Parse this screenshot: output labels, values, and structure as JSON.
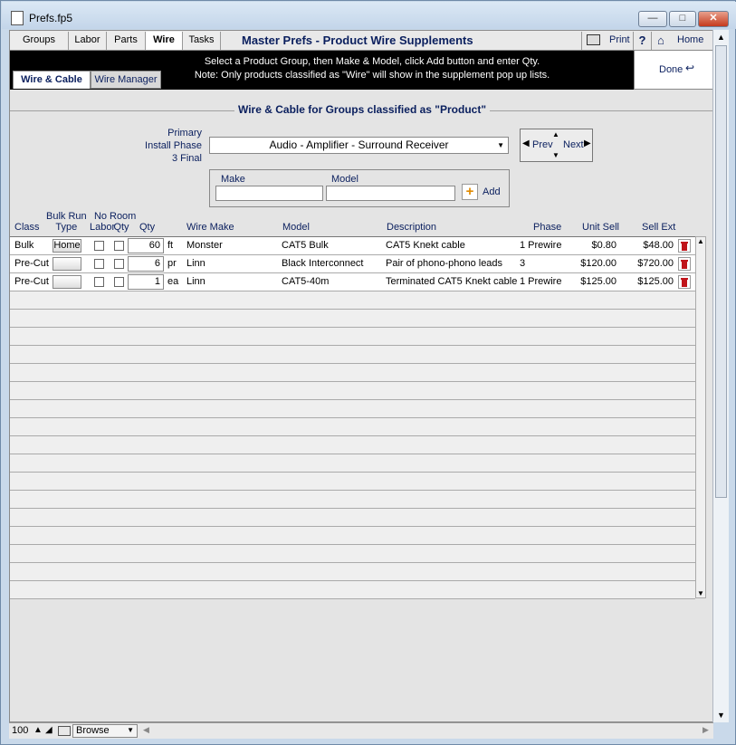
{
  "window": {
    "title": "Prefs.fp5"
  },
  "tabs": [
    {
      "label": "Groups",
      "active": false
    },
    {
      "label": "Labor",
      "active": false
    },
    {
      "label": "Parts",
      "active": false
    },
    {
      "label": "Wire",
      "active": true
    },
    {
      "label": "Tasks",
      "active": false
    }
  ],
  "header": {
    "title": "Master Prefs - Product Wire Supplements",
    "print_label": "Print",
    "help_label": "?",
    "home_label": "Home"
  },
  "instructions": {
    "line1": "Select a Product Group, then Make & Model, click Add button and enter Qty.",
    "line2": "Note: Only products classified as \"Wire\" will show in the supplement pop up lists."
  },
  "subtabs": [
    {
      "label": "Wire & Cable",
      "active": true
    },
    {
      "label": "Wire Manager",
      "active": false
    }
  ],
  "done_label": "Done",
  "section_title": "Wire & Cable for Groups classified as \"Product\"",
  "phase": {
    "label_line1": "Primary",
    "label_line2": "Install Phase",
    "label_line3": "3 Final",
    "group_value": "Audio - Amplifier - Surround Receiver"
  },
  "nav": {
    "prev": "Prev",
    "next": "Next"
  },
  "make_model": {
    "make_label": "Make",
    "model_label": "Model",
    "make_value": "",
    "model_value": "",
    "add_label": "Add"
  },
  "columns": {
    "class": "Class",
    "bulk_run_1": "Bulk Run",
    "bulk_run_2": "Type",
    "no_labor_1": "No",
    "no_labor_2": "Labor",
    "room_qty_1": "Room",
    "room_qty_2": "Qty",
    "qty": "Qty",
    "wire_make": "Wire Make",
    "model": "Model",
    "description": "Description",
    "phase": "Phase",
    "unit_sell": "Unit Sell",
    "sell_ext": "Sell Ext"
  },
  "rows": [
    {
      "class": "Bulk",
      "run_type": "Home",
      "qty": "60",
      "unit": "ft",
      "make": "Monster",
      "model": "CAT5 Bulk",
      "description": "CAT5 Knekt cable",
      "phase": "1 Prewire",
      "unit_sell": "$0.80",
      "sell_ext": "$48.00"
    },
    {
      "class": "Pre-Cut",
      "run_type": "",
      "qty": "6",
      "unit": "pr",
      "make": "Linn",
      "model": "Black Interconnect",
      "description": "Pair of phono-phono leads",
      "phase": "3",
      "unit_sell": "$120.00",
      "sell_ext": "$720.00"
    },
    {
      "class": "Pre-Cut",
      "run_type": "",
      "qty": "1",
      "unit": "ea",
      "make": "Linn",
      "model": "CAT5-40m",
      "description": "Terminated CAT5 Knekt cable",
      "phase": "1 Prewire",
      "unit_sell": "$125.00",
      "sell_ext": "$125.00"
    }
  ],
  "status": {
    "zoom": "100",
    "mode": "Browse"
  }
}
